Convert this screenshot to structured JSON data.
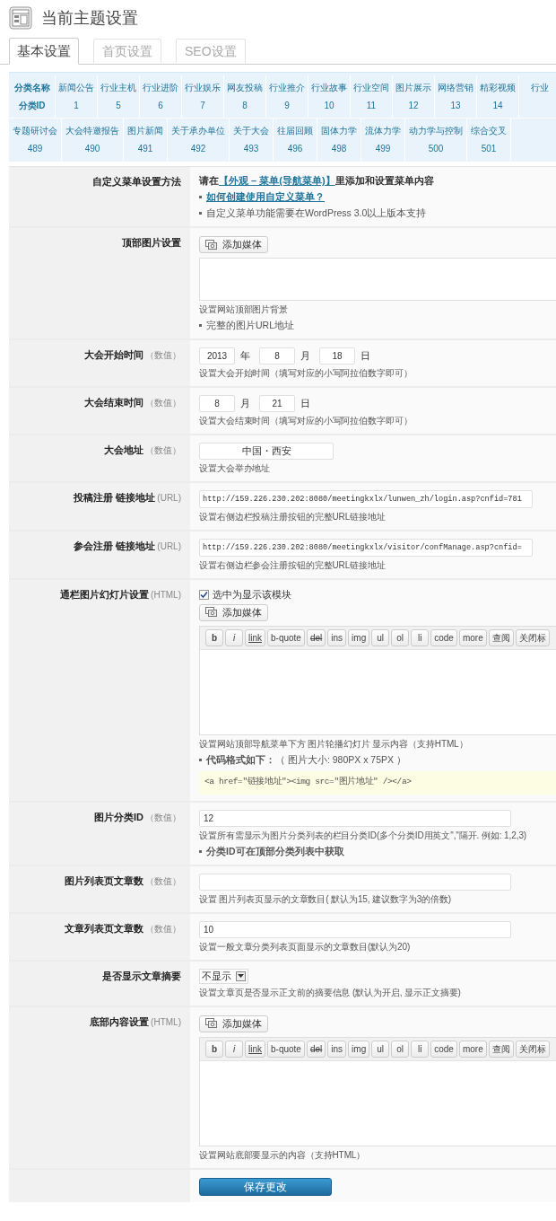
{
  "page_title": "当前主题设置",
  "tabs": [
    {
      "label": "基本设置",
      "selected": true
    },
    {
      "label": "首页设置",
      "selected": false
    },
    {
      "label": "SEO设置",
      "selected": false
    }
  ],
  "category_strips": [
    {
      "cells": [
        {
          "kind": "header",
          "name": "分类名称",
          "id": "分类ID"
        },
        {
          "name": "新闻公告",
          "id": "1"
        },
        {
          "name": "行业主机",
          "id": "5"
        },
        {
          "name": "行业进阶",
          "id": "6"
        },
        {
          "name": "行业娱乐",
          "id": "7"
        },
        {
          "name": "网友投稿",
          "id": "8"
        },
        {
          "name": "行业推介",
          "id": "9"
        },
        {
          "name": "行业故事",
          "id": "10"
        },
        {
          "name": "行业空间",
          "id": "11"
        },
        {
          "name": "图片展示",
          "id": "12"
        },
        {
          "name": "网络营销",
          "id": "13"
        },
        {
          "name": "精彩视频",
          "id": "14"
        },
        {
          "name": "行业"
        }
      ]
    },
    {
      "cells": [
        {
          "name": "专题研讨会",
          "id": "489"
        },
        {
          "name": "大会特邀报告",
          "id": "490"
        },
        {
          "name": "图片新闻",
          "id": "491"
        },
        {
          "name": "关于承办单位",
          "id": "492"
        },
        {
          "name": "关于大会",
          "id": "493"
        },
        {
          "name": "往届回顾",
          "id": "496"
        },
        {
          "name": "固体力学",
          "id": "498"
        },
        {
          "name": "流体力学",
          "id": "499"
        },
        {
          "name": "动力学与控制",
          "id": "500"
        },
        {
          "name": "综合交叉",
          "id": "501"
        }
      ]
    }
  ],
  "settings": [
    {
      "label": "自定义菜单设置方法",
      "items": [
        {
          "kind": "sentence",
          "before": "请在",
          "link": "【外观 – 菜单(导航菜单)】",
          "after": "里添加和设置菜单内容"
        },
        {
          "kind": "link_bullet",
          "text": "如何创建使用自定义菜单？"
        },
        {
          "kind": "bullet",
          "text": "自定义菜单功能需要在WordPress 3.0以上版本支持"
        }
      ]
    },
    {
      "label": "顶部图片设置",
      "items": [
        {
          "kind": "media_button",
          "label": "添加媒体"
        },
        {
          "kind": "textarea"
        },
        {
          "kind": "help",
          "text": "设置网站顶部图片背景"
        },
        {
          "kind": "bullet",
          "text": "完整的图片URL地址"
        }
      ]
    },
    {
      "label": "大会开始时间",
      "note": "（数值）",
      "items": [
        {
          "kind": "date_fields",
          "fields": [
            {
              "value": "2013",
              "unit": "年"
            },
            {
              "value": "8",
              "unit": "月"
            },
            {
              "value": "18",
              "unit": "日"
            }
          ]
        },
        {
          "kind": "help",
          "text": "设置大会开始时间（填写对应的小写阿拉伯数字即可）"
        }
      ]
    },
    {
      "label": "大会结束时间",
      "note": "（数值）",
      "items": [
        {
          "kind": "date_fields",
          "fields": [
            {
              "value": "8",
              "unit": "月"
            },
            {
              "value": "21",
              "unit": "日"
            }
          ]
        },
        {
          "kind": "help",
          "text": "设置大会结束时间（填写对应的小写阿拉伯数字即可）"
        }
      ]
    },
    {
      "label": "大会地址",
      "note": "（数值）",
      "items": [
        {
          "kind": "short_input",
          "value": "中国・西安"
        },
        {
          "kind": "help",
          "text": "设置大会举办地址"
        }
      ]
    },
    {
      "label": "投稿注册 链接地址",
      "note": "(URL)",
      "items": [
        {
          "kind": "url_input",
          "value": "http://159.226.230.202:8080/meetingkxlx/lunwen_zh/login.asp?cnfid=781"
        },
        {
          "kind": "help",
          "text": "设置右侧边栏投稿注册按钮的完整URL链接地址"
        }
      ]
    },
    {
      "label": "参会注册 链接地址",
      "note": "(URL)",
      "items": [
        {
          "kind": "url_input",
          "value": "http://159.226.230.202:8080/meetingkxlx/visitor/confManage.asp?cnfid="
        },
        {
          "kind": "help",
          "text": "设置右侧边栏参会注册按钮的完整URL链接地址"
        }
      ]
    },
    {
      "label": "通栏图片幻灯片设置",
      "note": "(HTML)",
      "items": [
        {
          "kind": "checkbox",
          "label": "选中为显示该模块",
          "checked": true
        },
        {
          "kind": "media_button",
          "label": "添加媒体"
        },
        {
          "kind": "editor",
          "buttons": [
            {
              "label": "b",
              "kind": "bold"
            },
            {
              "label": "i",
              "kind": "italic"
            },
            {
              "label": "link",
              "kind": "underline"
            },
            {
              "label": "b-quote",
              "kind": "plain"
            },
            {
              "label": "del",
              "kind": "strike"
            },
            {
              "label": "ins",
              "kind": "plain"
            },
            {
              "label": "img",
              "kind": "plain"
            },
            {
              "label": "ul",
              "kind": "plain"
            },
            {
              "label": "ol",
              "kind": "plain"
            },
            {
              "label": "li",
              "kind": "plain"
            },
            {
              "label": "code",
              "kind": "plain"
            },
            {
              "label": "more",
              "kind": "plain"
            },
            {
              "label": "查阅",
              "kind": "plain"
            },
            {
              "label": "关闭标",
              "kind": "plain"
            }
          ]
        },
        {
          "kind": "help",
          "text": "设置网站顶部导航菜单下方 图片轮播幻灯片 显示内容（支持HTML）"
        },
        {
          "kind": "bullet",
          "text": "**代码格式如下：**（ 图片大小: 980PX x 75PX ）"
        },
        {
          "kind": "code",
          "text": "<a href=\"链接地址\"><img src=\"图片地址\" /></a>"
        }
      ]
    },
    {
      "label": "图片分类ID",
      "note": "（数值）",
      "items": [
        {
          "kind": "input",
          "value": "12"
        },
        {
          "kind": "help",
          "text": "设置所有需显示为图片分类列表的栏目分类ID(多个分类ID用英文\",\"隔开. 例如: 1,2,3)"
        },
        {
          "kind": "bullet",
          "text": "**分类ID可在顶部分类列表中获取**"
        }
      ]
    },
    {
      "label": "图片列表页文章数",
      "note": "（数值）",
      "items": [
        {
          "kind": "input"
        },
        {
          "kind": "help",
          "text": "设置 图片列表页显示的文章数目( 默认为15, 建议数字为3的倍数)"
        }
      ]
    },
    {
      "label": "文章列表页文章数",
      "note": "（数值）",
      "items": [
        {
          "kind": "input",
          "value": "10"
        },
        {
          "kind": "help",
          "text": "设置一般文章分类列表页面显示的文章数目(默认为20)"
        }
      ]
    },
    {
      "label": "是否显示文章摘要",
      "items": [
        {
          "kind": "select",
          "value": "不显示"
        },
        {
          "kind": "help",
          "text": "设置文章页是否显示正文前的摘要信息 (默认为开启, 显示正文摘要)"
        }
      ]
    },
    {
      "label": "底部内容设置",
      "note": "(HTML)",
      "items": [
        {
          "kind": "media_button",
          "label": "添加媒体"
        },
        {
          "kind": "editor",
          "buttons": [
            {
              "label": "b",
              "kind": "bold"
            },
            {
              "label": "i",
              "kind": "italic"
            },
            {
              "label": "link",
              "kind": "underline"
            },
            {
              "label": "b-quote",
              "kind": "plain"
            },
            {
              "label": "del",
              "kind": "strike"
            },
            {
              "label": "ins",
              "kind": "plain"
            },
            {
              "label": "img",
              "kind": "plain"
            },
            {
              "label": "ul",
              "kind": "plain"
            },
            {
              "label": "ol",
              "kind": "plain"
            },
            {
              "label": "li",
              "kind": "plain"
            },
            {
              "label": "code",
              "kind": "plain"
            },
            {
              "label": "more",
              "kind": "plain"
            },
            {
              "label": "查阅",
              "kind": "plain"
            },
            {
              "label": "关闭标",
              "kind": "plain"
            }
          ]
        },
        {
          "kind": "help",
          "text": "设置网站底部要显示的内容（支持HTML）"
        }
      ]
    }
  ],
  "save_button": "保存更改"
}
